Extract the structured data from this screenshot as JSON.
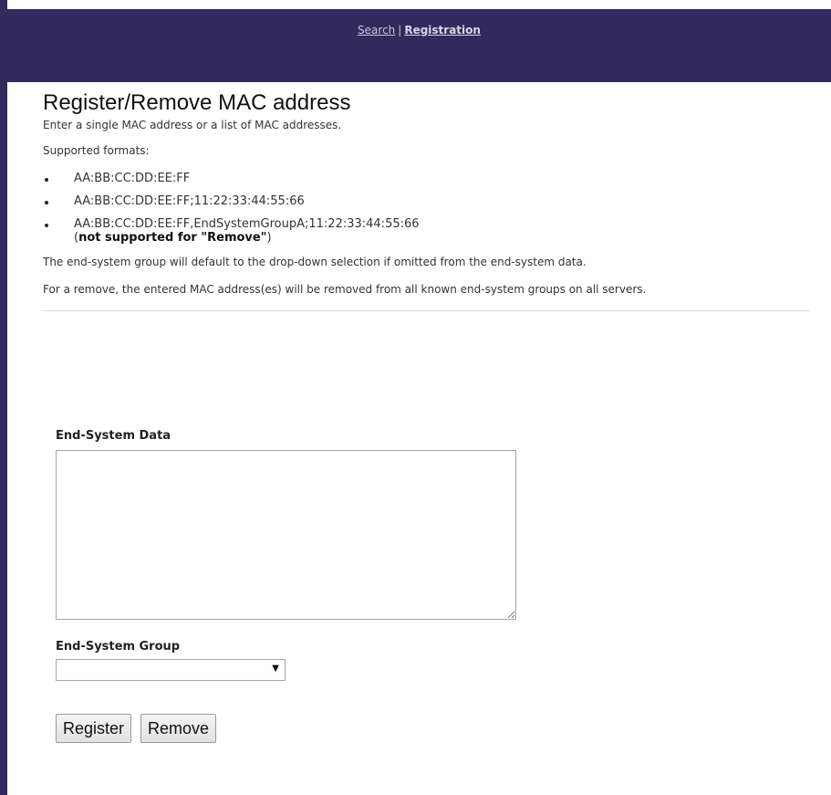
{
  "nav": {
    "search_label": "Search",
    "separator": "|",
    "registration_label": "Registration"
  },
  "page": {
    "title": "Register/Remove MAC address",
    "intro": "Enter a single MAC address or a list of MAC addresses.",
    "formats_label": "Supported formats:",
    "formats": [
      "AA:BB:CC:DD:EE:FF",
      "AA:BB:CC:DD:EE:FF;11:22:33:44:55:66",
      "AA:BB:CC:DD:EE:FF,EndSystemGroupA;11:22:33:44:55:66"
    ],
    "format3_note_open": "(",
    "format3_note_bold": "not supported for \"Remove\"",
    "format3_note_close": ")",
    "default_group_note": "The end-system group will default to the drop-down selection if omitted from the end-system data.",
    "remove_note": "For a remove, the entered MAC address(es) will be removed from all known end-system groups on all servers."
  },
  "form": {
    "data_label": "End-System Data",
    "data_value": "",
    "group_label": "End-System Group",
    "group_selected": "",
    "register_button": "Register",
    "remove_button": "Remove"
  },
  "colors": {
    "header_bg": "#32295c"
  },
  "icons": {
    "dropdown": "chevron-down-icon"
  }
}
